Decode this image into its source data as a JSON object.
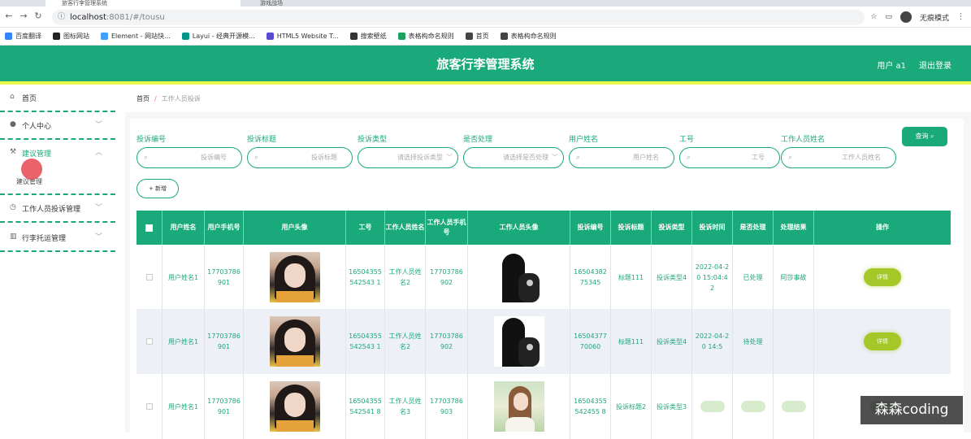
{
  "browser": {
    "tabs": [
      "旅客行李管理系统",
      "游戏战场"
    ],
    "url_host": "localhost",
    "url_rest": ":8081/#/tousu",
    "profile_label": "无痕模式",
    "bookmarks": [
      {
        "label": "百度翻译",
        "color": "#3385ff"
      },
      {
        "label": "图标网站",
        "color": "#222222"
      },
      {
        "label": "Element - 网站快...",
        "color": "#409eff"
      },
      {
        "label": "Layui - 经典开源模...",
        "color": "#009688"
      },
      {
        "label": "HTML5 Website T...",
        "color": "#5b4bd1"
      },
      {
        "label": "搜索壁纸",
        "color": "#333333"
      },
      {
        "label": "表格构命名规则",
        "color": "#19a15f"
      },
      {
        "label": "首页",
        "color": "#444444"
      },
      {
        "label": "表格构命名规则",
        "color": "#444444"
      }
    ]
  },
  "header": {
    "title": "旅客行李管理系统",
    "user": "用户 a1",
    "logout": "退出登录",
    "color": "#1aa97a"
  },
  "sidebar": {
    "items": [
      {
        "label": "首页",
        "icon": "home-icon",
        "glyph": "⌂"
      },
      {
        "label": "个人中心",
        "icon": "user-icon",
        "glyph": "●"
      },
      {
        "label": "建议管理",
        "icon": "tools-icon",
        "glyph": "⚒"
      },
      {
        "label": "工作人员投诉管理",
        "icon": "clock-icon",
        "glyph": "◷"
      },
      {
        "label": "行李托运管理",
        "icon": "chart-icon",
        "glyph": "▥"
      }
    ],
    "sub_item": "建议管理"
  },
  "breadcrumb": {
    "home": "首页",
    "sep": "/",
    "current": "工作人员投诉"
  },
  "filters": [
    {
      "label": "投诉编号",
      "placeholder": "投诉编号",
      "type": "input"
    },
    {
      "label": "投诉标题",
      "placeholder": "投诉标题",
      "type": "input"
    },
    {
      "label": "投诉类型",
      "placeholder": "请选择投诉类型",
      "type": "select"
    },
    {
      "label": "是否处理",
      "placeholder": "请选择是否处理",
      "type": "select"
    },
    {
      "label": "用户姓名",
      "placeholder": "用户姓名",
      "type": "input"
    },
    {
      "label": "工号",
      "placeholder": "工号",
      "type": "input"
    },
    {
      "label": "工作人员姓名",
      "placeholder": "工作人员姓名",
      "type": "input"
    }
  ],
  "query_button": "查询 ⌕",
  "add_button": "+ 新增",
  "table": {
    "headers": [
      "",
      "用户姓名",
      "用户手机号",
      "用户头像",
      "工号",
      "工作人员姓名",
      "工作人员手机号",
      "工作人员头像",
      "投诉编号",
      "投诉标题",
      "投诉类型",
      "投诉时间",
      "是否处理",
      "处理结果",
      "操作"
    ],
    "rows": [
      {
        "user_name": "用户姓名1",
        "user_phone": "17703786901",
        "user_avatar": "girl",
        "job_no": "16504355542543 1",
        "staff_name": "工作人员姓名2",
        "staff_phone": "17703786902",
        "staff_avatar": "boy",
        "complaint_no": "1650438275345",
        "complaint_title": "标题111",
        "complaint_type": "投诉类型4",
        "complaint_time": "2022-04-20 15:04:42",
        "handled": "已处理",
        "result": "阿莎事故",
        "action": "详情",
        "action_style": "button"
      },
      {
        "user_name": "用户姓名1",
        "user_phone": "17703786901",
        "user_avatar": "girl",
        "job_no": "16504355542543 1",
        "staff_name": "工作人员姓名2",
        "staff_phone": "17703786902",
        "staff_avatar": "boy",
        "complaint_no": "1650437770060",
        "complaint_title": "标题111",
        "complaint_type": "投诉类型4",
        "complaint_time": "2022-04-20 14:5",
        "handled": "待处理",
        "result": "",
        "action": "详情",
        "action_style": "button"
      },
      {
        "user_name": "用户姓名1",
        "user_phone": "17703786901",
        "user_avatar": "girl",
        "job_no": "16504355542541 8",
        "staff_name": "工作人员姓名3",
        "staff_phone": "17703786903",
        "staff_avatar": "woman",
        "complaint_no": "16504355542455 8",
        "complaint_title": "投诉标题2",
        "complaint_type": "投诉类型3",
        "complaint_time": "",
        "handled": "",
        "result": "",
        "action": "",
        "action_style": "blurred"
      }
    ]
  },
  "watermark": "森森coding"
}
